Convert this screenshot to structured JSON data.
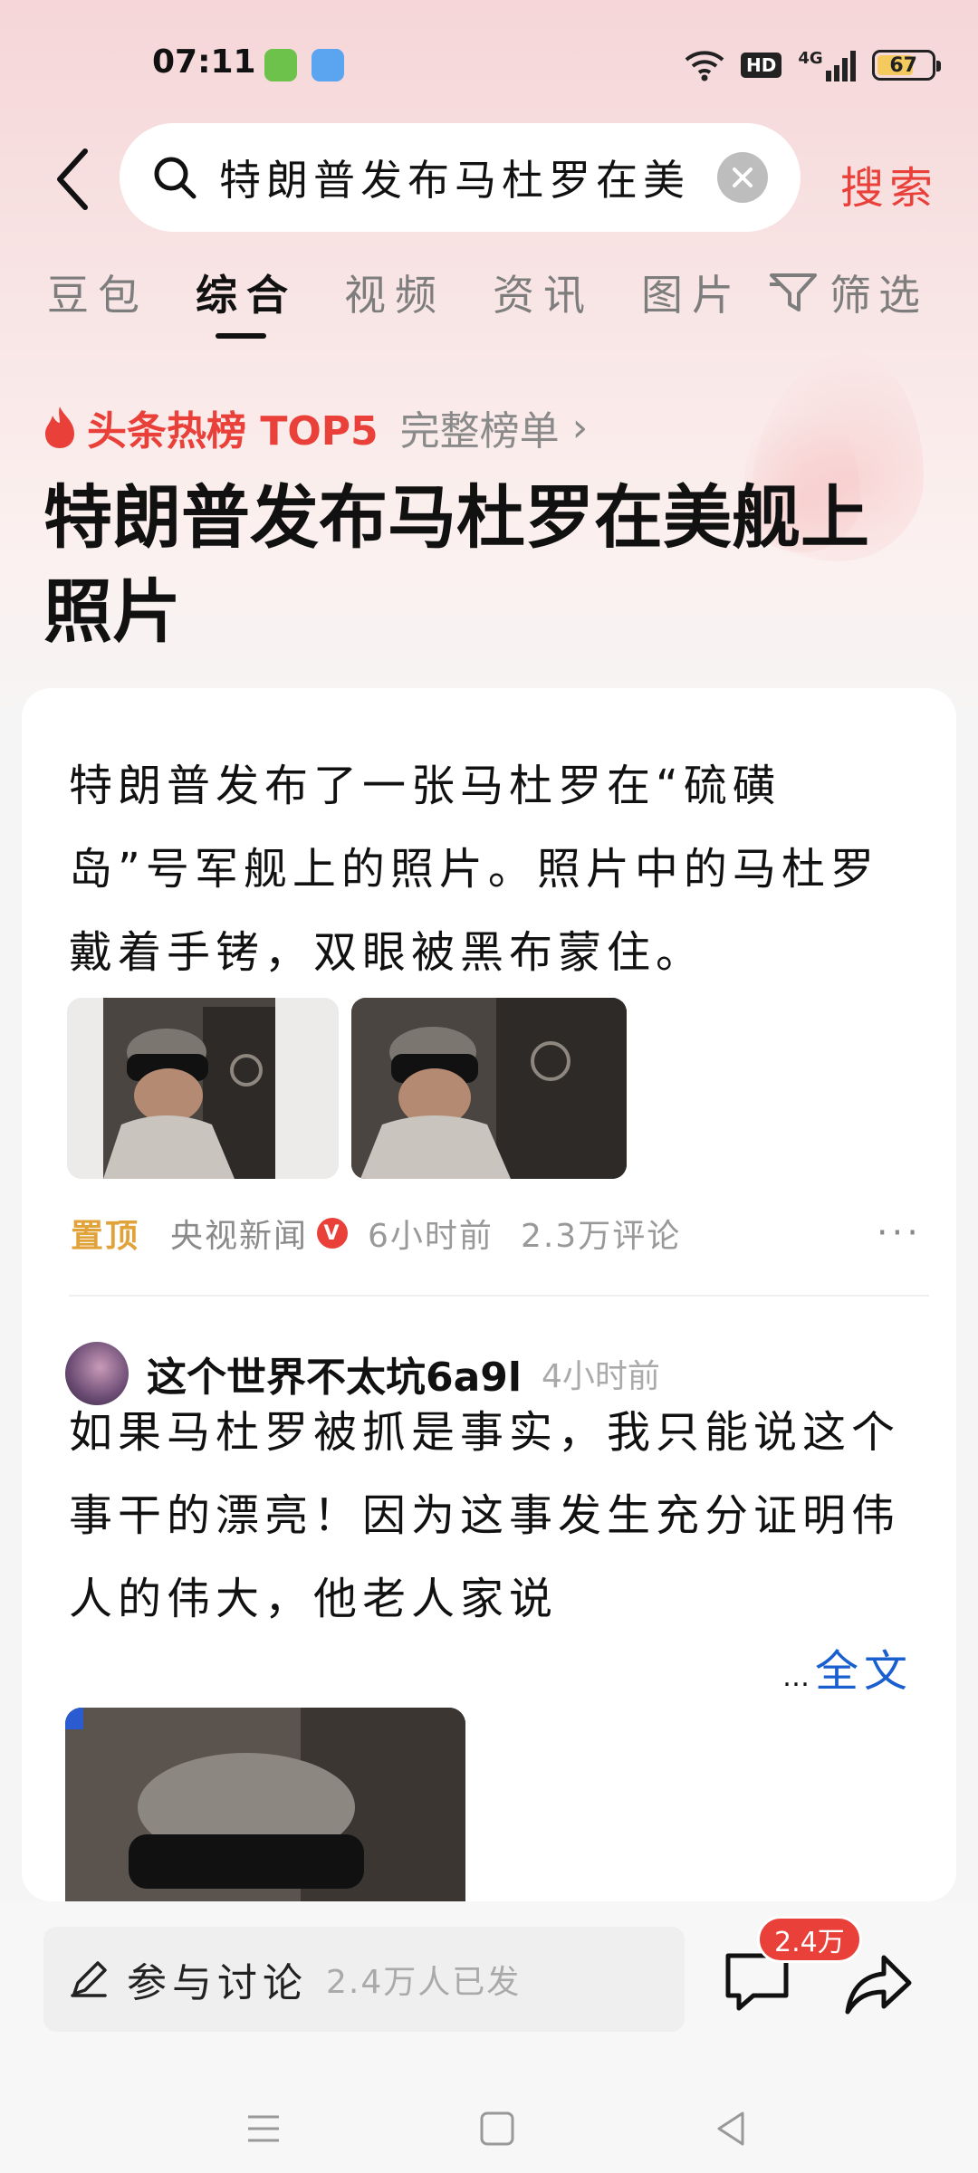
{
  "status_bar": {
    "time": "07:11",
    "network_label": "HD",
    "signal_label": "4G",
    "battery_level": "67",
    "battery_fraction": 0.67
  },
  "search": {
    "query": "特朗普发布马杜罗在美",
    "submit_label": "搜索"
  },
  "tabs": [
    {
      "label": "豆包",
      "active": false
    },
    {
      "label": "综合",
      "active": true
    },
    {
      "label": "视频",
      "active": false
    },
    {
      "label": "资讯",
      "active": false
    },
    {
      "label": "图片",
      "active": false
    }
  ],
  "filter_label": "筛选",
  "hot": {
    "label": "头条热榜 TOP5",
    "full_list_label": "完整榜单",
    "headline": "特朗普发布马杜罗在美舰上照片"
  },
  "top_card": {
    "summary": "特朗普发布了一张马杜罗在“硫磺岛”号军舰上的照片。照片中的马杜罗戴着手铐，双眼被黑布蒙住。",
    "pin_label": "置顶",
    "source": "央视新闻",
    "verified_mark": "V",
    "time_ago": "6小时前",
    "comment_count": "2.3万评论",
    "more": "···"
  },
  "post": {
    "author": "这个世界不太坑6a9l",
    "time_ago": "4小时前",
    "text": "如果马杜罗被抓是事实，我只能说这个事干的漂亮！因为这事发生充分证明伟人的伟大，他老人家说",
    "ellipsis": "…",
    "read_more": "全文"
  },
  "bottom": {
    "comment_label": "参与讨论",
    "participants": "2.4万人已发",
    "comments_badge": "2.4万"
  },
  "colors": {
    "accent": "#e9403a",
    "link": "#1a5fcf",
    "pin": "#e2a23a"
  }
}
